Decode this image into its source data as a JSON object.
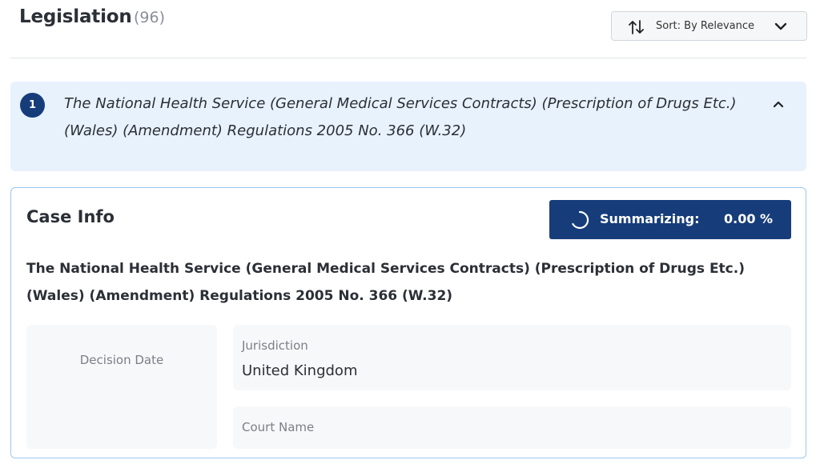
{
  "header": {
    "title": "Legislation",
    "count": "(96)",
    "sort_label": "Sort: By Relevance"
  },
  "result": {
    "number": "1",
    "title": "The National Health Service (General Medical Services Contracts) (Prescription of Drugs Etc.) (Wales) (Amendment) Regulations 2005 No. 366 (W.32)"
  },
  "case_info": {
    "heading": "Case Info",
    "summarizing_label": "Summarizing:",
    "summarizing_progress": "0.00 %",
    "case_title": "The National Health Service (General Medical Services Contracts) (Prescription of Drugs Etc.) (Wales) (Amendment) Regulations 2005 No. 366 (W.32)",
    "decision_date_label": "Decision Date",
    "jurisdiction_label": "Jurisdiction",
    "jurisdiction_value": "United Kingdom",
    "court_name_label": "Court Name"
  },
  "colors": {
    "accent": "#163d7a",
    "card_bg": "#e8f2fd",
    "card_border": "#9ec7ee"
  },
  "icons": {
    "sort": "sort-arrows-icon",
    "sort_dropdown": "chevron-down-icon",
    "collapse": "chevron-up-icon",
    "loading": "spinner-icon"
  }
}
